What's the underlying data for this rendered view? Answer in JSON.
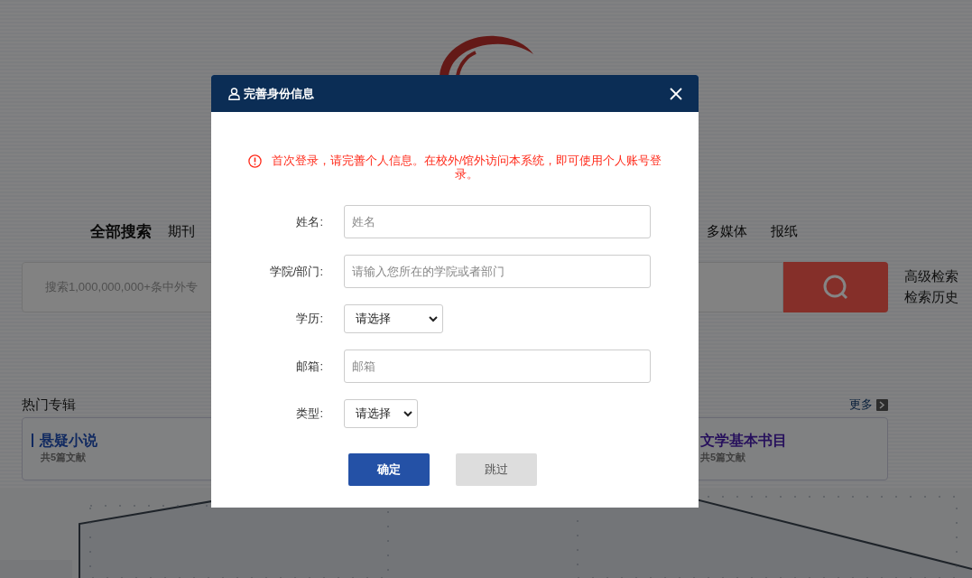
{
  "search_tabs": [
    {
      "label": "全部搜索",
      "selected": true
    },
    {
      "label": "期刊",
      "selected": false
    },
    {
      "label": "多媒体",
      "selected": false
    },
    {
      "label": "报纸",
      "selected": false
    }
  ],
  "search": {
    "placeholder": "搜索1,000,000,000+条中外专"
  },
  "search_links": [
    "高级检索",
    "检索历史"
  ],
  "section": {
    "title": "热门专辑",
    "more": "更多"
  },
  "cards": [
    {
      "title": "悬疑小说",
      "count": "共5篇文献"
    },
    {
      "title": "文学基本书目",
      "count": "共5篇文献"
    }
  ],
  "dialog": {
    "title": "完善身份信息",
    "notice": "首次登录，请完善个人信息。在校外/馆外访问本系统，即可使用个人账号登录。",
    "fields": [
      {
        "kind": "text",
        "label": "姓名:",
        "placeholder": "姓名"
      },
      {
        "kind": "text",
        "label": "学院/部门:",
        "placeholder": "请输入您所在的学院或者部门"
      },
      {
        "kind": "select",
        "label": "学历:",
        "value": "请选择"
      },
      {
        "kind": "text",
        "label": "邮箱:",
        "placeholder": "邮箱"
      },
      {
        "kind": "select",
        "label": "类型:",
        "value": "请选择"
      }
    ],
    "buttons": [
      {
        "label": "确定",
        "kind": "primary"
      },
      {
        "label": "跳过",
        "kind": "secondary"
      }
    ]
  }
}
